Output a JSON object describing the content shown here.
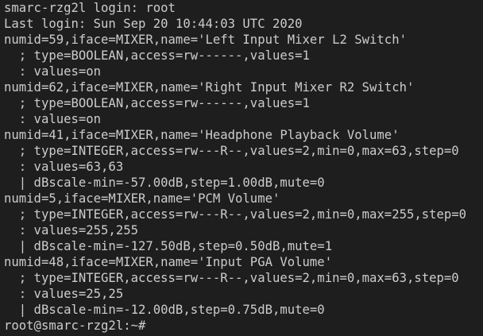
{
  "terminal": {
    "lines": [
      "smarc-rzg2l login: root",
      "Last login: Sun Sep 20 10:44:03 UTC 2020",
      "numid=59,iface=MIXER,name='Left Input Mixer L2 Switch'",
      "  ; type=BOOLEAN,access=rw------,values=1",
      "  : values=on",
      "numid=62,iface=MIXER,name='Right Input Mixer R2 Switch'",
      "  ; type=BOOLEAN,access=rw------,values=1",
      "  : values=on",
      "numid=41,iface=MIXER,name='Headphone Playback Volume'",
      "  ; type=INTEGER,access=rw---R--,values=2,min=0,max=63,step=0",
      "  : values=63,63",
      "  | dBscale-min=-57.00dB,step=1.00dB,mute=0",
      "numid=5,iface=MIXER,name='PCM Volume'",
      "  ; type=INTEGER,access=rw---R--,values=2,min=0,max=255,step=0",
      "  : values=255,255",
      "  | dBscale-min=-127.50dB,step=0.50dB,mute=1",
      "numid=48,iface=MIXER,name='Input PGA Volume'",
      "  ; type=INTEGER,access=rw---R--,values=2,min=0,max=63,step=0",
      "  : values=25,25",
      "  | dBscale-min=-12.00dB,step=0.75dB,mute=0"
    ],
    "prompt": "root@smarc-rzg2l:~#",
    "colors": {
      "background": "#1e1e1e",
      "foreground": "#cccccc"
    }
  }
}
